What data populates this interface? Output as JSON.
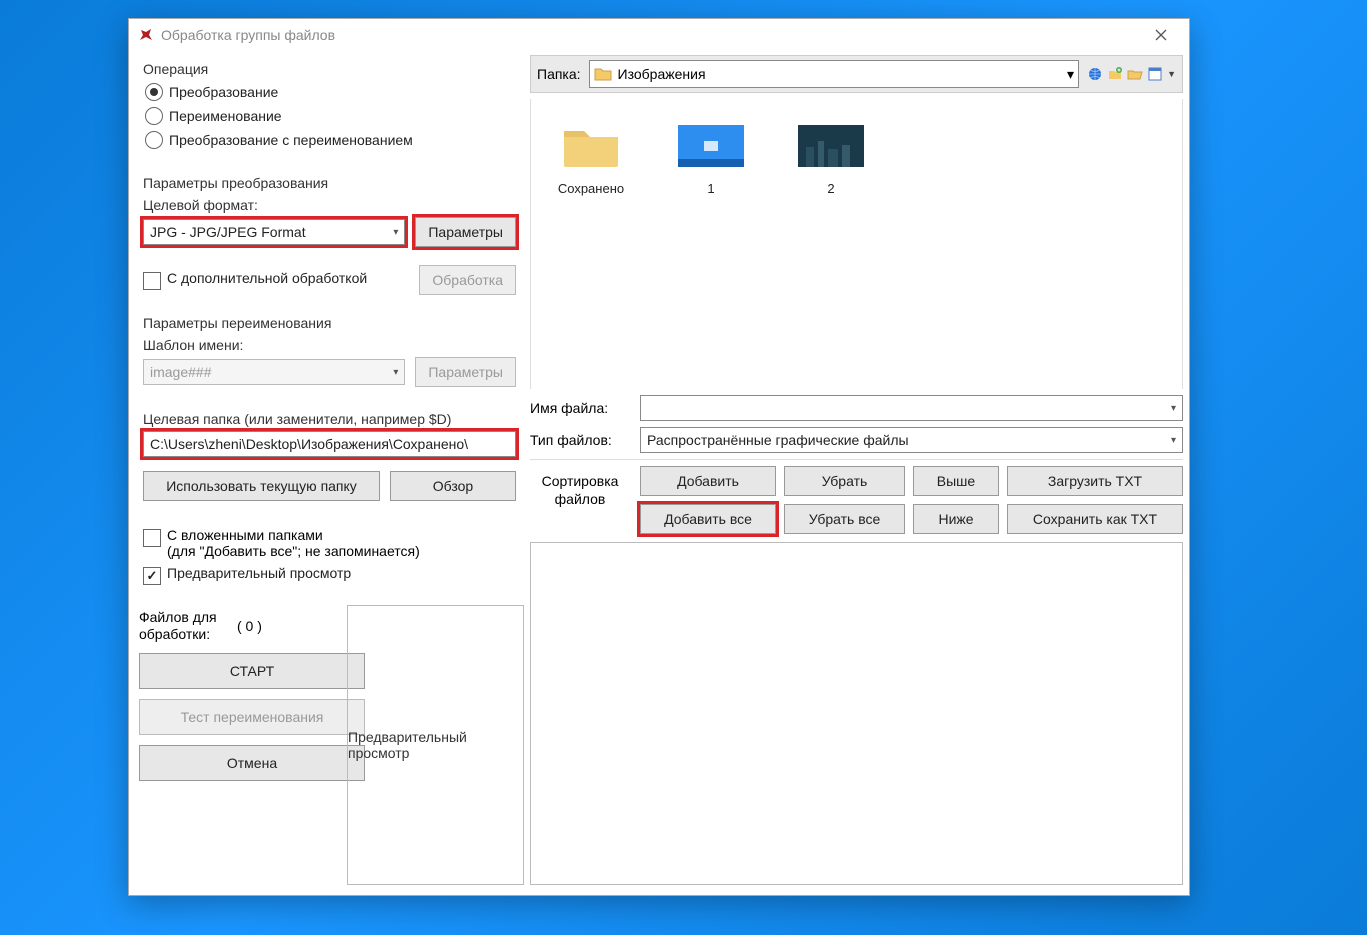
{
  "window": {
    "title": "Обработка группы файлов"
  },
  "operation": {
    "group_label": "Операция",
    "opt_convert": "Преобразование",
    "opt_rename": "Переименование",
    "opt_both": "Преобразование с переименованием"
  },
  "convert": {
    "group_label": "Параметры преобразования",
    "target_format_label": "Целевой формат:",
    "target_format_value": "JPG - JPG/JPEG Format",
    "params_btn": "Параметры",
    "extra_processing": "С дополнительной обработкой",
    "processing_btn": "Обработка"
  },
  "rename": {
    "group_label": "Параметры переименования",
    "template_label": "Шаблон имени:",
    "template_placeholder": "image###",
    "params_btn": "Параметры"
  },
  "target_folder": {
    "label": "Целевая папка (или заменители, например $D)",
    "value": "C:\\Users\\zheni\\Desktop\\Изображения\\Сохранено\\",
    "use_current": "Использовать текущую папку",
    "browse": "Обзор"
  },
  "options": {
    "with_subfolders_line1": "С вложенными папками",
    "with_subfolders_line2": "(для \"Добавить все\"; не запоминается)",
    "preview": "Предварительный просмотр"
  },
  "start": {
    "files_label": "Файлов для обработки:",
    "count": "( 0 )",
    "start_btn": "СТАРТ",
    "test_btn": "Тест переименования",
    "cancel_btn": "Отмена"
  },
  "preview_box": "Предварительный просмотр",
  "right": {
    "folder_label": "Папка:",
    "folder_value": "Изображения",
    "filename_label": "Имя файла:",
    "filetype_label": "Тип файлов:",
    "filetype_value": "Распространённые графические файлы",
    "sort_label": "Сортировка файлов",
    "btn_add": "Добавить",
    "btn_remove": "Убрать",
    "btn_up": "Выше",
    "btn_loadtxt": "Загрузить TXT",
    "btn_addall": "Добавить все",
    "btn_removeall": "Убрать все",
    "btn_down": "Ниже",
    "btn_savetxt": "Сохранить как TXT"
  },
  "files": {
    "item0": "Сохранено",
    "item1": "1",
    "item2": "2"
  }
}
